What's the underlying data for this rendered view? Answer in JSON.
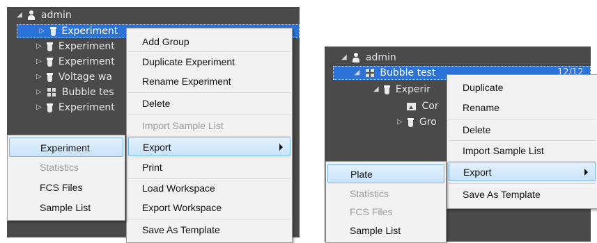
{
  "left": {
    "tree": {
      "root": "admin",
      "items": [
        "Experiment",
        "Experiment",
        "Experiment",
        "Voltage wa",
        "Bubble tes",
        "Experiment"
      ]
    },
    "context_menu": [
      "Add Group",
      "Duplicate Experiment",
      "Rename Experiment",
      "Delete",
      "Import Sample List",
      "Export",
      "Print",
      "Load Workspace",
      "Export Workspace",
      "Save As Template"
    ],
    "export_submenu": [
      "Experiment",
      "Statistics",
      "FCS Files",
      "Sample List"
    ]
  },
  "right": {
    "tree": {
      "root": "admin",
      "plate": "Bubble test",
      "plate_count": "12/12",
      "experiment": "Experir",
      "child1": "Cor",
      "child2": "Gro"
    },
    "context_menu": [
      "Duplicate",
      "Rename",
      "Delete",
      "Import Sample List",
      "Export",
      "Save As Template"
    ],
    "export_submenu": [
      "Plate",
      "Statistics",
      "FCS Files",
      "Sample List"
    ]
  }
}
